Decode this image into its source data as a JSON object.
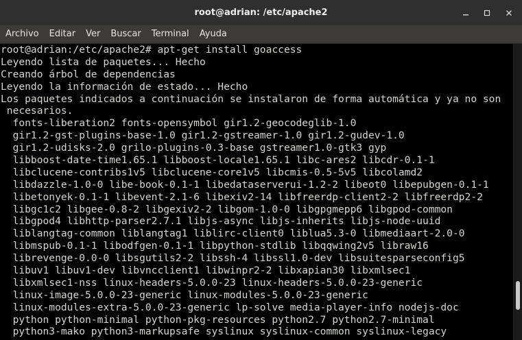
{
  "window": {
    "title": "root@adrian: /etc/apache2",
    "controls": {
      "minimize": "–",
      "maximize": "□",
      "close": "✕"
    }
  },
  "menubar": {
    "items": [
      "Archivo",
      "Editar",
      "Ver",
      "Buscar",
      "Terminal",
      "Ayuda"
    ]
  },
  "terminal": {
    "lines": [
      "root@adrian:/etc/apache2# apt-get install goaccess",
      "Leyendo lista de paquetes... Hecho",
      "Creando árbol de dependencias",
      "Leyendo la información de estado... Hecho",
      "Los paquetes indicados a continuación se instalaron de forma automática y ya no son",
      " necesarios.",
      "  fonts-liberation2 fonts-opensymbol gir1.2-geocodeglib-1.0",
      "  gir1.2-gst-plugins-base-1.0 gir1.2-gstreamer-1.0 gir1.2-gudev-1.0",
      "  gir1.2-udisks-2.0 grilo-plugins-0.3-base gstreamer1.0-gtk3 gyp",
      "  libboost-date-time1.65.1 libboost-locale1.65.1 libc-ares2 libcdr-0.1-1",
      "  libclucene-contribs1v5 libclucene-core1v5 libcmis-0.5-5v5 libcolamd2",
      "  libdazzle-1.0-0 libe-book-0.1-1 libedataserverui-1.2-2 libeot0 libepubgen-0.1-1",
      "  libetonyek-0.1-1 libevent-2.1-6 libexiv2-14 libfreerdp-client2-2 libfreerdp2-2",
      "  libgc1c2 libgee-0.8-2 libgexiv2-2 libgom-1.0-0 libgpgmepp6 libgpod-common",
      "  libgpod4 libhttp-parser2.7.1 libjs-async libjs-inherits libjs-node-uuid",
      "  liblangtag-common liblangtag1 liblirc-client0 liblua5.3-0 libmediaart-2.0-0",
      "  libmspub-0.1-1 libodfgen-0.1-1 libpython-stdlib libqqwing2v5 libraw16",
      "  librevenge-0.0-0 libsgutils2-2 libssh-4 libssl1.0-dev libsuitesparseconfig5",
      "  libuv1 libuv1-dev libvncclient1 libwinpr2-2 libxapian30 libxmlsec1",
      "  libxmlsec1-nss linux-headers-5.0.0-23 linux-headers-5.0.0-23-generic",
      "  linux-image-5.0.0-23-generic linux-modules-5.0.0-23-generic",
      "  linux-modules-extra-5.0.0-23-generic lp-solve media-player-info nodejs-doc",
      "  python python-minimal python-pkg-resources python2.7 python2.7-minimal",
      "  python3-mako python3-markupsafe syslinux syslinux-common syslinux-legacy"
    ]
  }
}
